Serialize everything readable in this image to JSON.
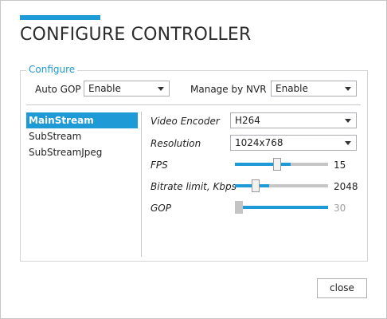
{
  "dialog": {
    "title": "CONFIGURE CONTROLLER",
    "accent_color": "#1e9ad6"
  },
  "configure": {
    "legend": "Configure",
    "auto_gop": {
      "label": "Auto GOP",
      "value": "Enable"
    },
    "manage_by_nvr": {
      "label": "Manage by NVR",
      "value": "Enable"
    }
  },
  "streams": {
    "items": [
      "MainStream",
      "SubStream",
      "SubStreamJpeg"
    ],
    "selected": "MainStream"
  },
  "settings": {
    "video_encoder": {
      "label": "Video Encoder",
      "value": "H264"
    },
    "resolution": {
      "label": "Resolution",
      "value": "1024x768"
    },
    "fps": {
      "label": "FPS",
      "value": "15",
      "level": 0.45
    },
    "bitrate": {
      "label": "Bitrate limit, Kbps",
      "value": "2048",
      "level": 0.2
    },
    "gop": {
      "label": "GOP",
      "value": "30",
      "level": 0.0,
      "disabled": true
    }
  },
  "buttons": {
    "close": "close"
  }
}
